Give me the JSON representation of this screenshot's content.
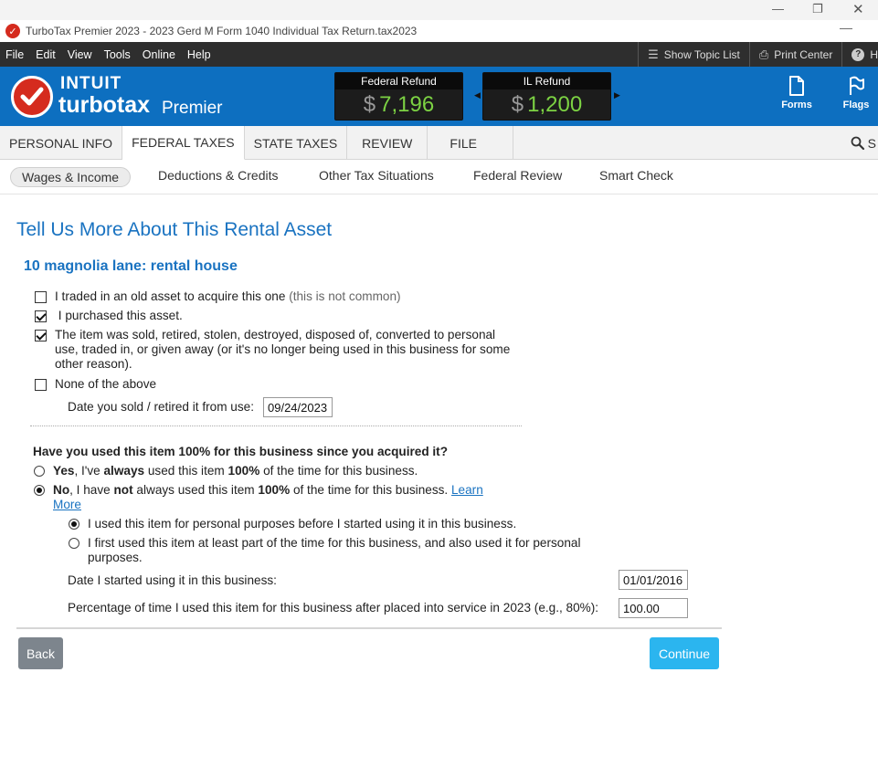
{
  "window": {
    "title": "TurboTax Premier 2023 - 2023 Gerd M Form 1040  Individual Tax Return.tax2023",
    "minimize_glyph": "—"
  },
  "menu": {
    "items": [
      "File",
      "Edit",
      "View",
      "Tools",
      "Online",
      "Help"
    ],
    "show_topic_list": "Show Topic List",
    "print_center": "Print Center",
    "help_short": "H"
  },
  "brand": {
    "intuit": "INTUIT",
    "turbotax": "turbotax",
    "edition": "Premier",
    "accent_color": "#0d6fc0",
    "check_color": "#d52b1e"
  },
  "refunds": {
    "federal": {
      "label": "Federal Refund",
      "currency": "$",
      "amount": "7,196"
    },
    "state": {
      "label": "IL Refund",
      "currency": "$",
      "amount": "1,200"
    }
  },
  "header_buttons": {
    "forms": "Forms",
    "flags": "Flags"
  },
  "tabs": {
    "items": [
      "PERSONAL INFO",
      "FEDERAL TAXES",
      "STATE TAXES",
      "REVIEW",
      "FILE"
    ],
    "active": "FEDERAL TAXES",
    "search_short": "S"
  },
  "subtabs": {
    "items": [
      "Wages & Income",
      "Deductions & Credits",
      "Other Tax Situations",
      "Federal Review",
      "Smart Check"
    ],
    "active": "Wages & Income"
  },
  "page": {
    "title": "Tell Us More About This Rental Asset",
    "asset_name": "10 magnolia lane: rental house",
    "options": {
      "traded": {
        "text": "I traded in an old asset to acquire this one",
        "note": "(this is not common)",
        "checked": false
      },
      "purchased": {
        "text": " I purchased this asset.",
        "checked": true
      },
      "sold": {
        "line1": "The item was sold, retired, stolen, destroyed, disposed of, converted to personal",
        "line2": "use, traded in, or given away (or it's no longer being used in this business for some",
        "line3": "other reason).",
        "checked": true
      },
      "none": {
        "text": "None of the above",
        "checked": false
      }
    },
    "date_sold_label": "Date you sold / retired it from use:",
    "date_sold_value": "09/24/2023",
    "question": "Have you used this item 100% for this business since you acquired it?",
    "yes": {
      "bold1": "Yes",
      "t1": ", I've ",
      "bold2": "always",
      "t2": " used this item ",
      "bold3": "100%",
      "t3": " of the time for this business.",
      "checked": false
    },
    "no": {
      "bold1": "No",
      "t1": ", I have ",
      "bold2": "not",
      "t2": " always used this item ",
      "bold3": "100%",
      "t3": " of the time for this business. ",
      "link1": "Learn",
      "link2": "More",
      "checked": true
    },
    "sub_personal_before": {
      "text": "I used this item for personal purposes before I started using it in this business.",
      "checked": true
    },
    "sub_part_time": {
      "line1": "I first used this item at least part of the time for this business, and also used it for personal",
      "line2": "purposes.",
      "checked": false
    },
    "date_started_label": "Date I started using it in this business:",
    "date_started_value": "01/01/2016",
    "percentage_label": "Percentage of time I used this item for this business after placed into service in 2023 (e.g., 80%):",
    "percentage_value": "100.00"
  },
  "footer": {
    "back": "Back",
    "continue": "Continue"
  }
}
